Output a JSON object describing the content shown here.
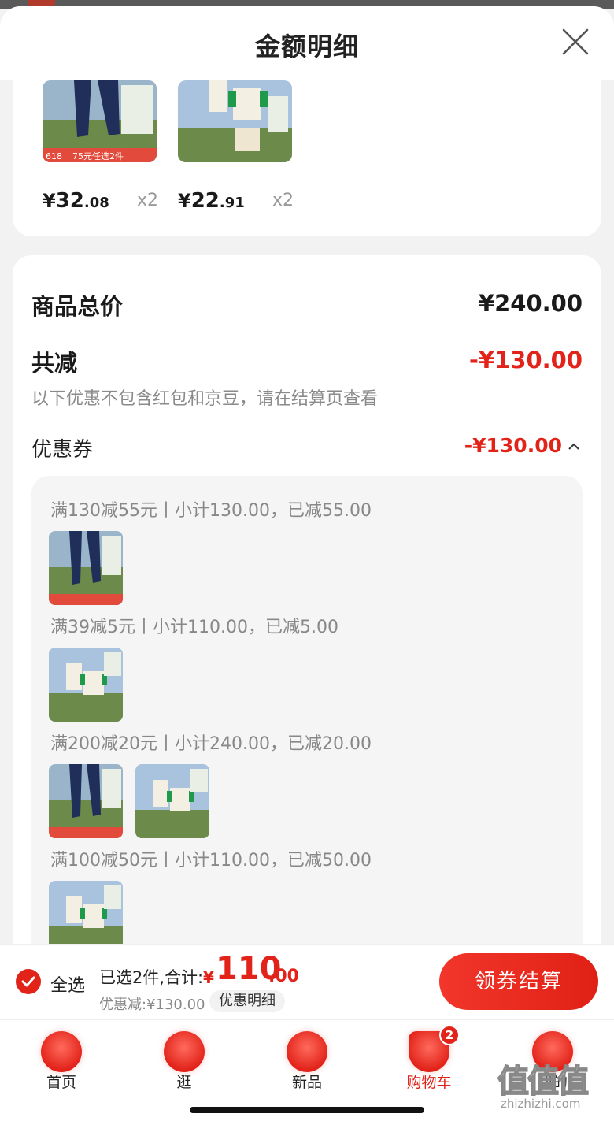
{
  "sheet": {
    "title": "金额明细"
  },
  "products": [
    {
      "yen": "¥",
      "int": "32",
      "dec": ".08",
      "qty": "x2",
      "badge": "618",
      "promo": "75元任选2件"
    },
    {
      "yen": "¥",
      "int": "22",
      "dec": ".91",
      "qty": "x2"
    }
  ],
  "breakdown": {
    "total_label": "商品总价",
    "total_value": "¥240.00",
    "reduce_label": "共减",
    "reduce_value": "-¥130.00",
    "note": "以下优惠不包含红包和京豆，请在结算页查看",
    "coupon_label": "优惠券",
    "coupon_value": "-¥130.00"
  },
  "coupons": [
    {
      "line": "满130减55元丨小计130.00，已减55.00"
    },
    {
      "line": "满39减5元丨小计110.00，已减5.00"
    },
    {
      "line": "满200减20元丨小计240.00，已减20.00"
    },
    {
      "line": "满100减50元丨小计110.00，已减50.00"
    }
  ],
  "checkout": {
    "select_all": "全选",
    "selected_text": "已选2件,合计:",
    "total_yen": "¥",
    "total_int": "110",
    "total_dec": ".00",
    "discount_text": "优惠减:¥130.00",
    "detail_chip": "优惠明细",
    "button": "领券结算"
  },
  "tabs": [
    {
      "label": "首页"
    },
    {
      "label": "逛"
    },
    {
      "label": "新品"
    },
    {
      "label": "购物车",
      "badge": "2"
    },
    {
      "label": "我的"
    }
  ],
  "watermark": {
    "big": "值值值",
    "small": "zhizhizhi.com"
  },
  "colors": {
    "accent": "#e2231a",
    "muted": "#888888"
  }
}
